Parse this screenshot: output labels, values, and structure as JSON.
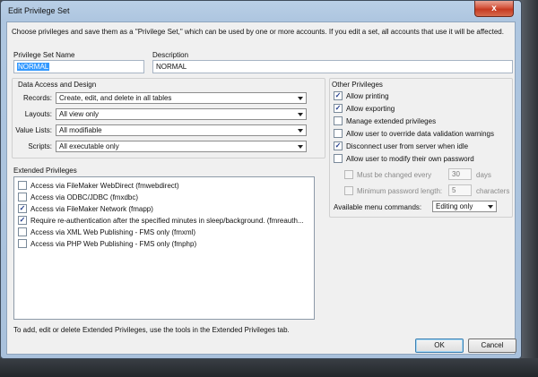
{
  "window": {
    "title": "Edit Privilege Set",
    "close_label": "x"
  },
  "intro": "Choose privileges and save them as a \"Privilege Set,\" which can be used by one or more accounts. If you edit a set, all accounts that use it will be affected.",
  "name_field": {
    "label": "Privilege Set Name",
    "value": "NORMAL"
  },
  "description_field": {
    "label": "Description",
    "value": "NORMAL"
  },
  "data_access": {
    "title": "Data Access and Design",
    "rows": [
      {
        "label": "Records:",
        "value": "Create, edit, and delete in all tables"
      },
      {
        "label": "Layouts:",
        "value": "All view only"
      },
      {
        "label": "Value Lists:",
        "value": "All modifiable"
      },
      {
        "label": "Scripts:",
        "value": "All executable only"
      }
    ]
  },
  "other_privileges": {
    "title": "Other Privileges",
    "items": [
      {
        "label": "Allow printing",
        "checked": true
      },
      {
        "label": "Allow exporting",
        "checked": true
      },
      {
        "label": "Manage extended privileges",
        "checked": false
      },
      {
        "label": "Allow user to override data validation warnings",
        "checked": false
      },
      {
        "label": "Disconnect user from server when idle",
        "checked": true
      },
      {
        "label": "Allow user to modify their own password",
        "checked": false
      }
    ],
    "must_change": {
      "label": "Must be changed every",
      "value": "30",
      "unit": "days"
    },
    "min_length": {
      "label": "Minimum password length:",
      "value": "5",
      "unit": "characters"
    },
    "menu_commands": {
      "label": "Available menu commands:",
      "value": "Editing only"
    }
  },
  "extended": {
    "title": "Extended Privileges",
    "items": [
      {
        "label": "Access via FileMaker WebDirect (fmwebdirect)",
        "checked": false
      },
      {
        "label": "Access via ODBC/JDBC (fmxdbc)",
        "checked": false
      },
      {
        "label": "Access via FileMaker Network (fmapp)",
        "checked": true
      },
      {
        "label": "Require re-authentication after the specified minutes in sleep/background. (fmreauth...",
        "checked": true
      },
      {
        "label": "Access via XML Web Publishing - FMS only (fmxml)",
        "checked": false
      },
      {
        "label": "Access via PHP Web Publishing - FMS only (fmphp)",
        "checked": false
      }
    ],
    "footer": "To add, edit or delete Extended Privileges, use the tools in the Extended Privileges tab."
  },
  "buttons": {
    "ok": "OK",
    "cancel": "Cancel"
  },
  "colors": {
    "selection": "#3399ff",
    "close": "#c63b22",
    "frame": "#aec6e0"
  }
}
